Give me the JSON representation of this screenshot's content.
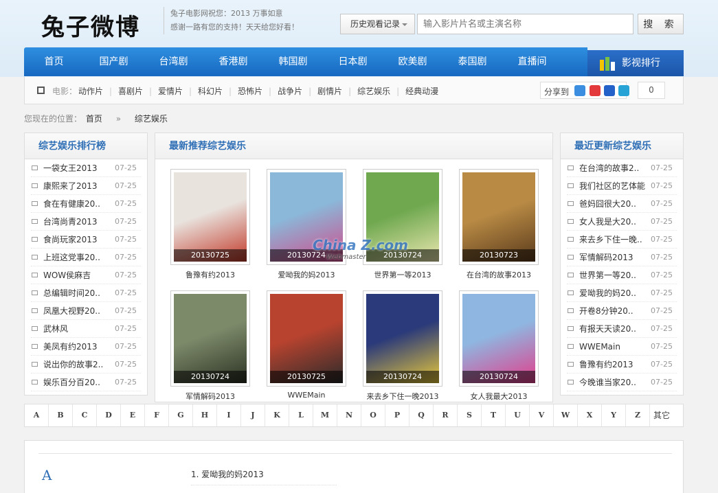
{
  "header": {
    "logo": "兔子微博",
    "slogan_line1": "兔子电影网祝您：2013 万事如意",
    "slogan_line2": "感谢一路有您的支持！天天给您好看！",
    "history_label": "历史观看记录",
    "search_placeholder": "输入影片片名或主演名称",
    "search_button": "搜 索"
  },
  "nav": {
    "items": [
      "首页",
      "国产剧",
      "台湾剧",
      "香港剧",
      "韩国剧",
      "日本剧",
      "欧美剧",
      "泰国剧",
      "直播间"
    ],
    "rank_label": "影视排行"
  },
  "subnav": {
    "label": "电影：",
    "items": [
      "动作片",
      "喜剧片",
      "爱情片",
      "科幻片",
      "恐怖片",
      "战争片",
      "剧情片",
      "综艺娱乐",
      "经典动漫"
    ],
    "share_label": "分享到",
    "share_count": "0"
  },
  "breadcrumb": {
    "prefix": "您现在的位置：",
    "home": "首页",
    "sep": "»",
    "current": "综艺娱乐"
  },
  "left_panel": {
    "title": "综艺娱乐排行榜",
    "items": [
      {
        "title": "一袋女王2013",
        "date": "07-25"
      },
      {
        "title": "康熙来了2013",
        "date": "07-25"
      },
      {
        "title": "食在有健康20..",
        "date": "07-25"
      },
      {
        "title": "台湾尚青2013",
        "date": "07-25"
      },
      {
        "title": "食尚玩家2013",
        "date": "07-25"
      },
      {
        "title": "上班这党事20..",
        "date": "07-25"
      },
      {
        "title": "WOW侯麻吉",
        "date": "07-25"
      },
      {
        "title": "总编辑时间20..",
        "date": "07-25"
      },
      {
        "title": "凤凰大视野20..",
        "date": "07-25"
      },
      {
        "title": "武林风",
        "date": "07-25"
      },
      {
        "title": "美凤有约2013",
        "date": "07-25"
      },
      {
        "title": "说出你的故事2..",
        "date": "07-25"
      },
      {
        "title": "娱乐百分百20..",
        "date": "07-25"
      }
    ]
  },
  "center_panel": {
    "title": "最新推荐综艺娱乐",
    "cards": [
      {
        "title": "鲁豫有约2013",
        "date": "20130725",
        "c1": "#e9e3de",
        "c2": "#c23a2a"
      },
      {
        "title": "爱呦我的妈2013",
        "date": "20130724",
        "c1": "#8bb7d8",
        "c2": "#d04a8a"
      },
      {
        "title": "世界第一等2013",
        "date": "20130724",
        "c1": "#6fa84f",
        "c2": "#eae7b0"
      },
      {
        "title": "在台湾的故事2013",
        "date": "20130723",
        "c1": "#b88a44",
        "c2": "#5a3a1c"
      },
      {
        "title": "军情解码2013",
        "date": "20130724",
        "c1": "#7d8a6a",
        "c2": "#2c3324"
      },
      {
        "title": "WWEMain",
        "date": "20130725",
        "c1": "#b8432f",
        "c2": "#2b2b2b"
      },
      {
        "title": "来去乡下住一晚2013",
        "date": "20130724",
        "c1": "#2b3a7a",
        "c2": "#e8c93a"
      },
      {
        "title": "女人我最大2013",
        "date": "20130724",
        "c1": "#8fb6e0",
        "c2": "#e23d8a"
      }
    ],
    "watermark_main": "China Z.com",
    "watermark_sub": "Webmaster"
  },
  "right_panel": {
    "title": "最近更新综艺娱乐",
    "items": [
      {
        "title": "在台湾的故事2..",
        "date": "07-25"
      },
      {
        "title": "我们社区的艺体能",
        "date": "07-25"
      },
      {
        "title": "爸妈囧很大20..",
        "date": "07-25"
      },
      {
        "title": "女人我是大20..",
        "date": "07-25"
      },
      {
        "title": "来去乡下住一晚..",
        "date": "07-25"
      },
      {
        "title": "军情解码2013",
        "date": "07-25"
      },
      {
        "title": "世界第一等20..",
        "date": "07-25"
      },
      {
        "title": "爱呦我的妈20..",
        "date": "07-25"
      },
      {
        "title": "开卷8分钟20..",
        "date": "07-25"
      },
      {
        "title": "有报天天读20..",
        "date": "07-25"
      },
      {
        "title": "WWEMain",
        "date": "07-25"
      },
      {
        "title": "鲁豫有约2013",
        "date": "07-25"
      },
      {
        "title": "今晚谁当家20..",
        "date": "07-25"
      }
    ]
  },
  "alphabet": [
    "A",
    "B",
    "C",
    "D",
    "E",
    "F",
    "G",
    "H",
    "I",
    "J",
    "K",
    "L",
    "M",
    "N",
    "O",
    "P",
    "Q",
    "R",
    "S",
    "T",
    "U",
    "V",
    "W",
    "X",
    "Y",
    "Z",
    "其它"
  ],
  "listing": {
    "letter": "A",
    "first_item": "1. 爱呦我的妈2013"
  },
  "colors": {
    "nav_blue": "#1f7ad4",
    "title_blue": "#2f6fb6",
    "rank_blue": "#2260b8"
  }
}
